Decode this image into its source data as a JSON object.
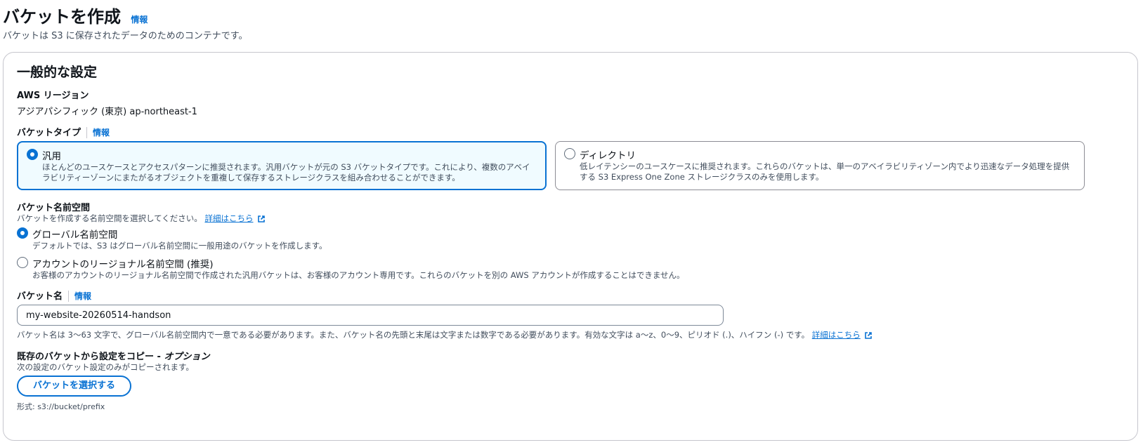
{
  "header": {
    "title": "バケットを作成",
    "info": "情報",
    "description": "バケットは S3 に保存されたデータのためのコンテナです。"
  },
  "general": {
    "title": "一般的な設定",
    "region_label": "AWS リージョン",
    "region_value": "アジアパシフィック (東京) ap-northeast-1"
  },
  "bucket_type": {
    "label": "バケットタイプ",
    "info": "情報",
    "options": [
      {
        "title": "汎用",
        "desc_line1": "ほとんどのユースケースとアクセスパターンに推奨されます。汎用バケットが元の S3 バケットタイプです。これにより、複数のアベイ",
        "desc_line2": "ラビリティーゾーンにまたがるオブジェクトを重複して保存するストレージクラスを組み合わせることができます。",
        "selected": true
      },
      {
        "title": "ディレクトリ",
        "desc_line1": "低レイテンシーのユースケースに推奨されます。これらのバケットは、単一のアベイラビリティゾーン内でより迅速なデータ処理を提供",
        "desc_line2": "する S3 Express One Zone ストレージクラスのみを使用します。",
        "selected": false
      }
    ]
  },
  "namespace": {
    "label": "バケット名前空間",
    "description": "バケットを作成する名前空間を選択してください。",
    "link": "詳細はこちら",
    "options": [
      {
        "title": "グローバル名前空間",
        "desc": "デフォルトでは、S3 はグローバル名前空間に一般用途のバケットを作成します。",
        "selected": true
      },
      {
        "title": "アカウントのリージョナル名前空間 (推奨)",
        "desc": "お客様のアカウントのリージョナル名前空間で作成された汎用バケットは、お客様のアカウント専用です。これらのバケットを別の AWS アカウントが作成することはできません。",
        "selected": false
      }
    ]
  },
  "bucket_name": {
    "label": "バケット名",
    "info": "情報",
    "value": "my-website-20260514-handson",
    "constraint": "バケット名は 3〜63 文字で、グローバル名前空間内で一意である必要があります。また、バケット名の先頭と末尾は文字または数字である必要があります。有効な文字は a〜z、0〜9、ピリオド (.)、ハイフン (-) です。",
    "link": "詳細はこちら"
  },
  "copy_settings": {
    "label_main": "既存のバケットから設定をコピー - ",
    "label_optional": "オプション",
    "description": "次の設定のバケット設定のみがコピーされます。",
    "button": "バケットを選択する",
    "format_hint": "形式: s3://bucket/prefix"
  },
  "colors": {
    "accent": "#0972d3",
    "selected_tile_bg": "#f0fbff",
    "text": "#0f141a",
    "secondary_text": "#414d5c"
  }
}
